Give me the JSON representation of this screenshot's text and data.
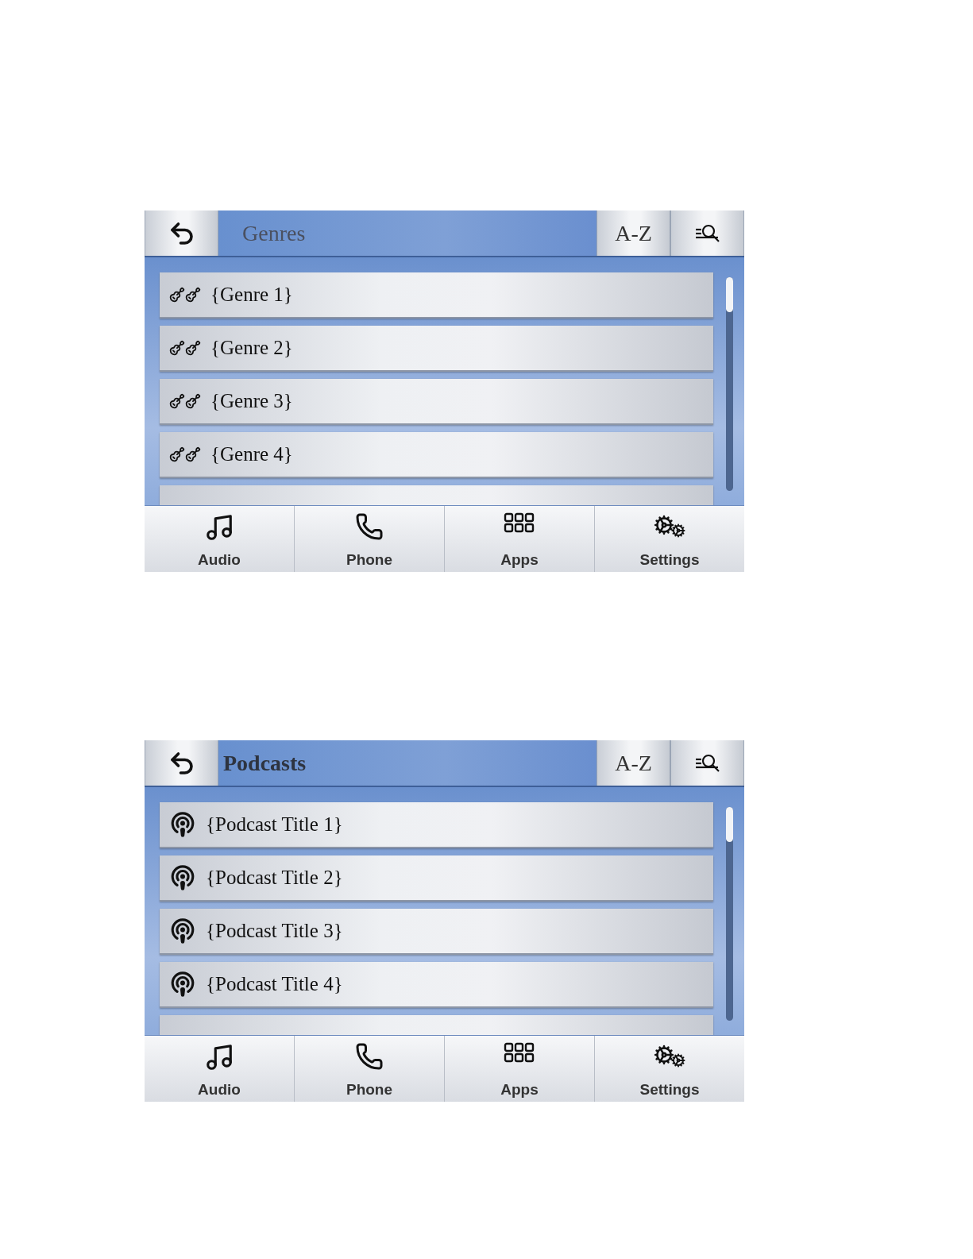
{
  "screens": [
    {
      "title": "Genres",
      "title_bold": false,
      "sort_button": "A-Z",
      "rows": [
        {
          "kind": "genre",
          "label": "{Genre 1}"
        },
        {
          "kind": "genre",
          "label": "{Genre 2}"
        },
        {
          "kind": "genre",
          "label": "{Genre 3}"
        },
        {
          "kind": "genre",
          "label": "{Genre 4}"
        }
      ],
      "nav": [
        {
          "kind": "audio",
          "label": "Audio"
        },
        {
          "kind": "phone",
          "label": "Phone"
        },
        {
          "kind": "apps",
          "label": "Apps"
        },
        {
          "kind": "settings",
          "label": "Settings"
        }
      ]
    },
    {
      "title": "Podcasts",
      "title_bold": true,
      "sort_button": "A-Z",
      "rows": [
        {
          "kind": "podcast",
          "label": "{Podcast Title 1}"
        },
        {
          "kind": "podcast",
          "label": "{Podcast Title 2}"
        },
        {
          "kind": "podcast",
          "label": "{Podcast Title 3}"
        },
        {
          "kind": "podcast",
          "label": "{Podcast Title 4}"
        }
      ],
      "nav": [
        {
          "kind": "audio",
          "label": "Audio"
        },
        {
          "kind": "phone",
          "label": "Phone"
        },
        {
          "kind": "apps",
          "label": "Apps"
        },
        {
          "kind": "settings",
          "label": "Settings"
        }
      ]
    }
  ]
}
